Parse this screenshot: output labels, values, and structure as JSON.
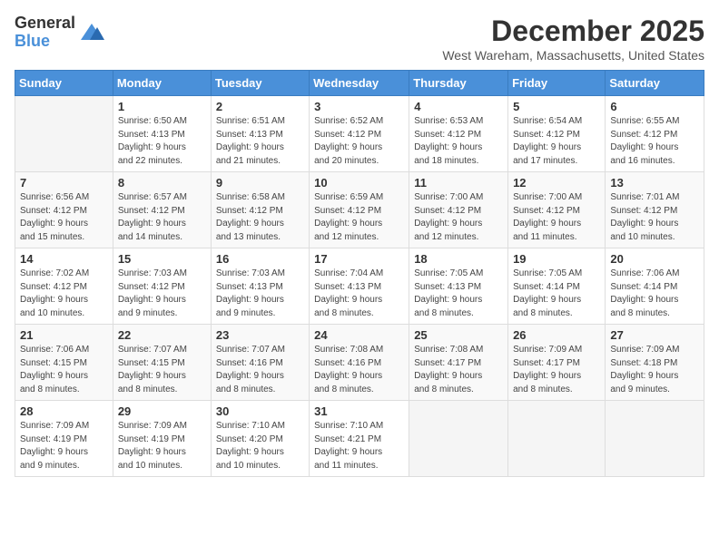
{
  "logo": {
    "general": "General",
    "blue": "Blue"
  },
  "title": "December 2025",
  "location": "West Wareham, Massachusetts, United States",
  "weekdays": [
    "Sunday",
    "Monday",
    "Tuesday",
    "Wednesday",
    "Thursday",
    "Friday",
    "Saturday"
  ],
  "weeks": [
    [
      {
        "day": "",
        "info": ""
      },
      {
        "day": "1",
        "info": "Sunrise: 6:50 AM\nSunset: 4:13 PM\nDaylight: 9 hours\nand 22 minutes."
      },
      {
        "day": "2",
        "info": "Sunrise: 6:51 AM\nSunset: 4:13 PM\nDaylight: 9 hours\nand 21 minutes."
      },
      {
        "day": "3",
        "info": "Sunrise: 6:52 AM\nSunset: 4:12 PM\nDaylight: 9 hours\nand 20 minutes."
      },
      {
        "day": "4",
        "info": "Sunrise: 6:53 AM\nSunset: 4:12 PM\nDaylight: 9 hours\nand 18 minutes."
      },
      {
        "day": "5",
        "info": "Sunrise: 6:54 AM\nSunset: 4:12 PM\nDaylight: 9 hours\nand 17 minutes."
      },
      {
        "day": "6",
        "info": "Sunrise: 6:55 AM\nSunset: 4:12 PM\nDaylight: 9 hours\nand 16 minutes."
      }
    ],
    [
      {
        "day": "7",
        "info": "Sunrise: 6:56 AM\nSunset: 4:12 PM\nDaylight: 9 hours\nand 15 minutes."
      },
      {
        "day": "8",
        "info": "Sunrise: 6:57 AM\nSunset: 4:12 PM\nDaylight: 9 hours\nand 14 minutes."
      },
      {
        "day": "9",
        "info": "Sunrise: 6:58 AM\nSunset: 4:12 PM\nDaylight: 9 hours\nand 13 minutes."
      },
      {
        "day": "10",
        "info": "Sunrise: 6:59 AM\nSunset: 4:12 PM\nDaylight: 9 hours\nand 12 minutes."
      },
      {
        "day": "11",
        "info": "Sunrise: 7:00 AM\nSunset: 4:12 PM\nDaylight: 9 hours\nand 12 minutes."
      },
      {
        "day": "12",
        "info": "Sunrise: 7:00 AM\nSunset: 4:12 PM\nDaylight: 9 hours\nand 11 minutes."
      },
      {
        "day": "13",
        "info": "Sunrise: 7:01 AM\nSunset: 4:12 PM\nDaylight: 9 hours\nand 10 minutes."
      }
    ],
    [
      {
        "day": "14",
        "info": "Sunrise: 7:02 AM\nSunset: 4:12 PM\nDaylight: 9 hours\nand 10 minutes."
      },
      {
        "day": "15",
        "info": "Sunrise: 7:03 AM\nSunset: 4:12 PM\nDaylight: 9 hours\nand 9 minutes."
      },
      {
        "day": "16",
        "info": "Sunrise: 7:03 AM\nSunset: 4:13 PM\nDaylight: 9 hours\nand 9 minutes."
      },
      {
        "day": "17",
        "info": "Sunrise: 7:04 AM\nSunset: 4:13 PM\nDaylight: 9 hours\nand 8 minutes."
      },
      {
        "day": "18",
        "info": "Sunrise: 7:05 AM\nSunset: 4:13 PM\nDaylight: 9 hours\nand 8 minutes."
      },
      {
        "day": "19",
        "info": "Sunrise: 7:05 AM\nSunset: 4:14 PM\nDaylight: 9 hours\nand 8 minutes."
      },
      {
        "day": "20",
        "info": "Sunrise: 7:06 AM\nSunset: 4:14 PM\nDaylight: 9 hours\nand 8 minutes."
      }
    ],
    [
      {
        "day": "21",
        "info": "Sunrise: 7:06 AM\nSunset: 4:15 PM\nDaylight: 9 hours\nand 8 minutes."
      },
      {
        "day": "22",
        "info": "Sunrise: 7:07 AM\nSunset: 4:15 PM\nDaylight: 9 hours\nand 8 minutes."
      },
      {
        "day": "23",
        "info": "Sunrise: 7:07 AM\nSunset: 4:16 PM\nDaylight: 9 hours\nand 8 minutes."
      },
      {
        "day": "24",
        "info": "Sunrise: 7:08 AM\nSunset: 4:16 PM\nDaylight: 9 hours\nand 8 minutes."
      },
      {
        "day": "25",
        "info": "Sunrise: 7:08 AM\nSunset: 4:17 PM\nDaylight: 9 hours\nand 8 minutes."
      },
      {
        "day": "26",
        "info": "Sunrise: 7:09 AM\nSunset: 4:17 PM\nDaylight: 9 hours\nand 8 minutes."
      },
      {
        "day": "27",
        "info": "Sunrise: 7:09 AM\nSunset: 4:18 PM\nDaylight: 9 hours\nand 9 minutes."
      }
    ],
    [
      {
        "day": "28",
        "info": "Sunrise: 7:09 AM\nSunset: 4:19 PM\nDaylight: 9 hours\nand 9 minutes."
      },
      {
        "day": "29",
        "info": "Sunrise: 7:09 AM\nSunset: 4:19 PM\nDaylight: 9 hours\nand 10 minutes."
      },
      {
        "day": "30",
        "info": "Sunrise: 7:10 AM\nSunset: 4:20 PM\nDaylight: 9 hours\nand 10 minutes."
      },
      {
        "day": "31",
        "info": "Sunrise: 7:10 AM\nSunset: 4:21 PM\nDaylight: 9 hours\nand 11 minutes."
      },
      {
        "day": "",
        "info": ""
      },
      {
        "day": "",
        "info": ""
      },
      {
        "day": "",
        "info": ""
      }
    ]
  ]
}
